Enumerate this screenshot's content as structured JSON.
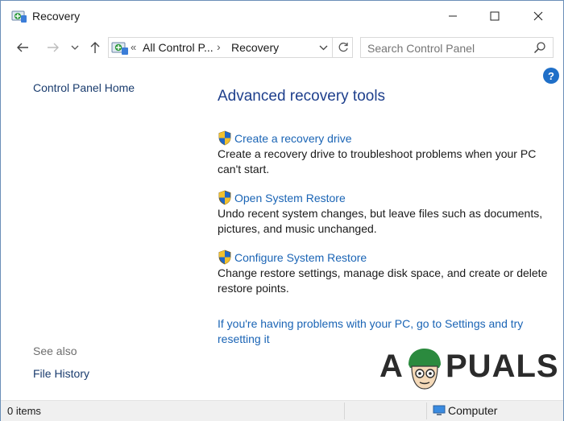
{
  "window": {
    "title": "Recovery",
    "buttons": {
      "minimize": "—",
      "maximize": "☐",
      "close": "✕"
    }
  },
  "nav": {
    "back": "←",
    "forward": "→",
    "recent": "⌄",
    "up": "↑",
    "address_chevron": "«",
    "address_segment_1": "All Control P...",
    "address_separator": "›",
    "address_segment_2": "Recovery",
    "address_dropdown": "⌄",
    "refresh": "↻",
    "search_placeholder": "Search Control Panel"
  },
  "sidebar": {
    "home": "Control Panel Home",
    "see_also": "See also",
    "file_history": "File History"
  },
  "main": {
    "help": "?",
    "heading": "Advanced recovery tools",
    "items": [
      {
        "link": "Create a recovery drive",
        "desc": "Create a recovery drive to troubleshoot problems when your PC can't start."
      },
      {
        "link": "Open System Restore",
        "desc": "Undo recent system changes, but leave files such as documents, pictures, and music unchanged."
      },
      {
        "link": "Configure System Restore",
        "desc": "Change restore settings, manage disk space, and create or delete restore points."
      }
    ],
    "settings_link": "If you're having problems with your PC, go to Settings and try resetting it"
  },
  "watermark": {
    "a": "A",
    "rest": "PUALS"
  },
  "statusbar": {
    "items": "0 items",
    "location": "Computer"
  },
  "colors": {
    "link": "#1a64b5",
    "heading": "#1e3f8c",
    "help_badge": "#1f6fc8",
    "status_bg": "#f0f0f0"
  },
  "icons": {
    "title": "control-panel-icon",
    "shield": "uac-shield-icon",
    "search": "magnifier-icon",
    "computer": "computer-icon"
  }
}
